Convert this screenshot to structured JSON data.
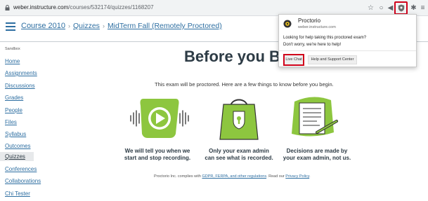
{
  "browser": {
    "url_domain": "weber.instructure.com",
    "url_path": "/courses/532174/quizzes/1168207",
    "extension_name": "Proctorio"
  },
  "header": {
    "breadcrumb": [
      "Course 2010",
      "Quizzes",
      "MidTerm Fall (Remotely Proctored)"
    ]
  },
  "sidebar": {
    "sandbox_label": "Sandbox",
    "items": [
      {
        "label": "Home"
      },
      {
        "label": "Assignments"
      },
      {
        "label": "Discussions"
      },
      {
        "label": "Grades"
      },
      {
        "label": "People"
      },
      {
        "label": "Files"
      },
      {
        "label": "Syllabus"
      },
      {
        "label": "Outcomes"
      },
      {
        "label": "Quizzes",
        "active": true
      },
      {
        "label": "Conferences"
      },
      {
        "label": "Collaborations"
      },
      {
        "label": "Chi Tester"
      }
    ]
  },
  "main": {
    "title": "Before you Begin",
    "intro": "This exam will be proctored. Here are a few things to know before you begin.",
    "features": [
      {
        "icon": "audio-play-icon",
        "caption_line1": "We will tell you when we",
        "caption_line2": "start and stop recording."
      },
      {
        "icon": "lock-bag-icon",
        "caption_line1": "Only your exam admin",
        "caption_line2": "can see what is recorded."
      },
      {
        "icon": "document-pen-icon",
        "caption_line1": "Decisions are made by",
        "caption_line2": "your exam admin, not us."
      }
    ],
    "compliance_prefix": "Proctorio Inc. complies with ",
    "compliance_link": "GDPR, FERPA, and other regulations",
    "compliance_mid": ". Read our ",
    "compliance_policy": "Privacy Policy",
    "compliance_suffix": "."
  },
  "popup": {
    "title": "Proctorio",
    "domain": "weber.instructure.com",
    "line1": "Looking for help taking this proctored exam?",
    "line2": "Don't worry, we're here to help!",
    "live_chat_label": "Live Chat",
    "support_label": "Help and Support Center"
  },
  "colors": {
    "accent_green": "#8dc63f",
    "link_blue": "#2d6ea1",
    "highlight_red": "#d0021b"
  }
}
